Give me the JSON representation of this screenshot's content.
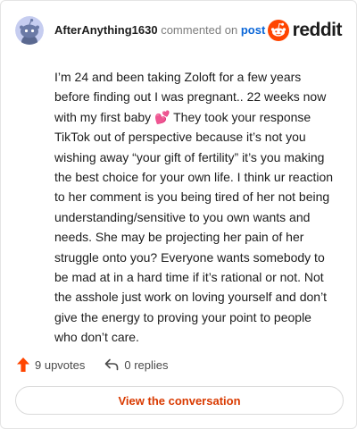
{
  "comment": {
    "username": "AfterAnything1630",
    "action_text": "commented on",
    "post_link": "post",
    "body_before_emoji": "I’m 24 and been taking Zoloft for a few years before finding out I was pregnant.. 22 weeks now with my first baby ",
    "emoji": "💕",
    "body_after_emoji": " They took your response TikTok out of perspective because it’s not you wishing away “your gift of fertility” it’s you making the best choice for your own life. I think ur reaction to her comment is you being tired of her not being understanding/sensitive to you own wants and needs. She may be projecting her pain of her struggle onto you? Everyone wants somebody to be mad at in a hard time if it’s rational or not. Not the asshole just work on loving yourself and don’t give the energy to proving your point to people who don’t care."
  },
  "brand": {
    "logo_text": "reddit",
    "color": "#ff4500"
  },
  "stats": {
    "upvotes": "9 upvotes",
    "replies": "0 replies"
  },
  "cta": {
    "label": "View the conversation"
  },
  "icons": {
    "avatar": "snoo-avatar",
    "logo": "reddit-logo-icon",
    "upvote": "upvote-arrow-icon",
    "reply": "reply-arrow-icon"
  }
}
